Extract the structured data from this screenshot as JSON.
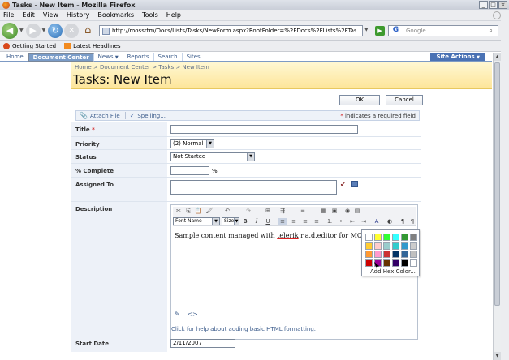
{
  "window": {
    "title": "Tasks - New Item - Mozilla Firefox"
  },
  "menu": [
    "File",
    "Edit",
    "View",
    "History",
    "Bookmarks",
    "Tools",
    "Help"
  ],
  "nav": {
    "url": "http://mossrtm/Docs/Lists/Tasks/NewForm.aspx?RootFolder=%2FDocs%2FLists%2FTasks&Source=http%",
    "search_placeholder": "Google",
    "search_engine": "G"
  },
  "bookmarks": [
    "Getting Started",
    "Latest Headlines"
  ],
  "sp_nav": {
    "tabs": [
      "Home",
      "Document Center",
      "News",
      "Reports",
      "Search",
      "Sites"
    ],
    "site_actions": "Site Actions"
  },
  "header": {
    "breadcrumb": "Home > Document Center > Tasks > New Item",
    "title": "Tasks: New Item"
  },
  "buttons": {
    "ok": "OK",
    "cancel": "Cancel"
  },
  "toolbar": {
    "attach": "Attach File",
    "spelling": "Spelling...",
    "required_note": "indicates a required field",
    "required_mark": "*"
  },
  "fields": {
    "title": {
      "label": "Title",
      "value": ""
    },
    "priority": {
      "label": "Priority",
      "value": "(2) Normal"
    },
    "status": {
      "label": "Status",
      "value": "Not Started"
    },
    "percent": {
      "label": "% Complete",
      "value": "",
      "suffix": "%"
    },
    "assigned": {
      "label": "Assigned To",
      "value": ""
    },
    "description": {
      "label": "Description"
    },
    "start_date": {
      "label": "Start Date",
      "value": "2/11/2007"
    }
  },
  "editor": {
    "font_label": "Font Name",
    "size_label": "Size",
    "content_before": "Sample content managed with ",
    "content_underlined": "telerik",
    "content_after": " r.a.d.editor for MOSS.",
    "help_link": "Click for help about adding basic HTML formatting."
  },
  "palette": {
    "colors": [
      "#ffffff",
      "#ffff33",
      "#33ff33",
      "#33ffff",
      "#339933",
      "#808080",
      "#ffcc33",
      "#ffcccc",
      "#99cccc",
      "#33cccc",
      "#3399cc",
      "#cccccc",
      "#ff9933",
      "#ff99cc",
      "#cc3333",
      "#003366",
      "#336699",
      "#c0c0c0",
      "#cc0000",
      "#990099",
      "#663300",
      "#330066",
      "#000000",
      "#ffffff"
    ],
    "add_hex": "Add Hex Color..."
  }
}
